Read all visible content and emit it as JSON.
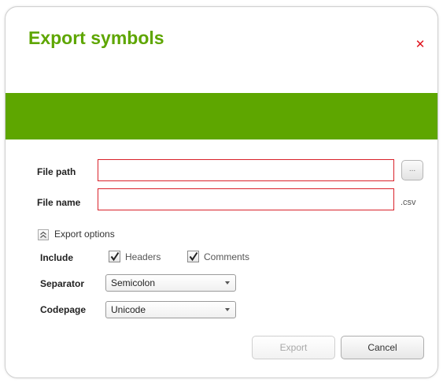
{
  "dialog": {
    "title": "Export symbols",
    "close_icon": "close-icon",
    "accent_color": "#5ea600",
    "error_color": "#d9222b"
  },
  "form": {
    "file_path": {
      "label": "File path",
      "value": "",
      "browse_label": "..."
    },
    "file_name": {
      "label": "File name",
      "value": "",
      "extension": ".csv"
    }
  },
  "export_options": {
    "title": "Export options",
    "toggle_icon": "collapse-icon",
    "include": {
      "label": "Include",
      "options": [
        {
          "label": "Headers",
          "checked": true
        },
        {
          "label": "Comments",
          "checked": true
        }
      ]
    },
    "separator": {
      "label": "Separator",
      "selected": "Semicolon"
    },
    "codepage": {
      "label": "Codepage",
      "selected": "Unicode"
    }
  },
  "buttons": {
    "export_label": "Export",
    "export_enabled": false,
    "cancel_label": "Cancel"
  }
}
